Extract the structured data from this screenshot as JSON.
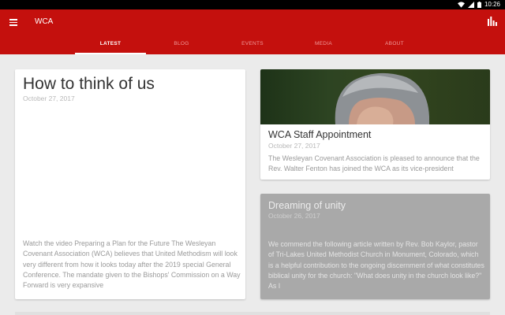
{
  "status_bar": {
    "time": "10:26",
    "icons": [
      "wifi-icon",
      "signal-icon",
      "battery-icon"
    ]
  },
  "app_bar": {
    "title": "WCA",
    "menu_icon": "menu-icon",
    "action_icon": "bar-chart-icon",
    "color": "#c4100d"
  },
  "tabs": [
    {
      "label": "LATEST",
      "active": true
    },
    {
      "label": "BLOG",
      "active": false
    },
    {
      "label": "EVENTS",
      "active": false
    },
    {
      "label": "MEDIA",
      "active": false
    },
    {
      "label": "ABOUT",
      "active": false
    }
  ],
  "articles": {
    "main": {
      "title": "How to think of us",
      "date": "October 27, 2017",
      "excerpt": "Watch the video Preparing a Plan for the Future The Wesleyan Covenant Association (WCA) believes that United Methodism will look very different from how it looks today after the 2019 special General Conference. The mandate given to the Bishops' Commission on a Way Forward is very expansive"
    },
    "staff": {
      "title": "WCA Staff Appointment",
      "date": "October 27, 2017",
      "excerpt": "The Wesleyan Covenant Association is pleased to announce that the Rev. Walter Fenton has joined the WCA as its vice-president"
    },
    "unity": {
      "title": "Dreaming of unity",
      "date": "October 26, 2017",
      "excerpt": "We commend the following article written by Rev. Bob Kaylor, pastor of Tri-Lakes United Methodist Church in Monument, Colorado, which is a helpful contribution to the ongoing discernment of what constitutes biblical unity for the church: \"What does unity in the church look like?\" As I"
    }
  }
}
